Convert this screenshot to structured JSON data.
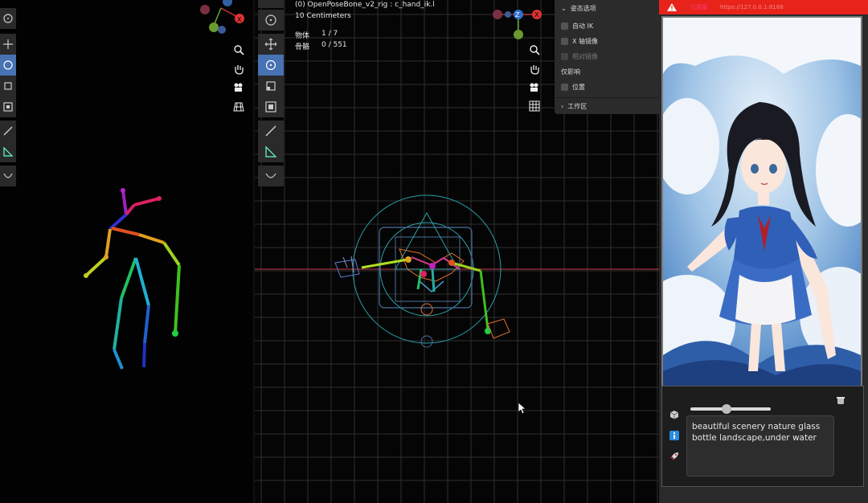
{
  "viewport": {
    "object_name": "(0) OpenPoseBone_v2_rig : c_hand_ik.l",
    "scale": "10 Centimeters",
    "objects_label": "物体",
    "objects_value": "1 / 7",
    "bones_label": "骨骼",
    "bones_value": "0 / 551"
  },
  "pose_panel": {
    "title": "姿态选项",
    "auto_ik": "自动 IK",
    "x_mirror": "X 轴镜像",
    "relative_mirror": "相对镜像",
    "affect_only": "仅影响",
    "location": "位置",
    "workspace": "工作区"
  },
  "gizmo": {
    "x": "X",
    "z": "Z"
  },
  "app": {
    "header_status": "已连接",
    "header_url": "https://127.0.0.1:8188",
    "prompt": "beautiful scenery nature glass bottle landscape,under water",
    "slider_value": 0.45
  },
  "colors": {
    "header_red": "#e8231a",
    "active_tool": "#4772b3",
    "grid": "#2f2f2f",
    "axis_red": "#a03040"
  }
}
